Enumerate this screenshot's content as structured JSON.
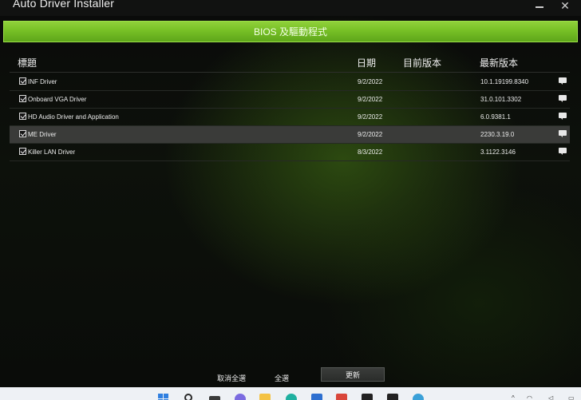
{
  "window": {
    "title": "Auto Driver Installer",
    "minimize_glyph": "—",
    "close_glyph": "✕"
  },
  "banner": {
    "label": "BIOS 及驅動程式"
  },
  "table": {
    "headers": {
      "title": "標題",
      "date": "日期",
      "current": "目前版本",
      "latest": "最新版本"
    },
    "rows": [
      {
        "name": "INF Driver",
        "date": "9/2/2022",
        "current": "",
        "latest": "10.1.19199.8340",
        "checked": true,
        "selected": false
      },
      {
        "name": "Onboard VGA Driver",
        "date": "9/2/2022",
        "current": "",
        "latest": "31.0.101.3302",
        "checked": true,
        "selected": false
      },
      {
        "name": "HD Audio Driver and Application",
        "date": "9/2/2022",
        "current": "",
        "latest": "6.0.9381.1",
        "checked": true,
        "selected": false
      },
      {
        "name": "ME Driver",
        "date": "9/2/2022",
        "current": "",
        "latest": "2230.3.19.0",
        "checked": true,
        "selected": true
      },
      {
        "name": "Killer LAN Driver",
        "date": "8/3/2022",
        "current": "",
        "latest": "3.1122.3146",
        "checked": true,
        "selected": false
      }
    ]
  },
  "actions": {
    "deselect_all": "取消全選",
    "select_all": "全選",
    "update": "更新"
  },
  "taskbar": {
    "icons": [
      "windows-start-icon",
      "search-icon",
      "task-view-icon",
      "chat-icon",
      "file-explorer-icon",
      "edge-icon",
      "store-icon",
      "gift-icon",
      "app-icon",
      "app-icon",
      "globe-icon"
    ],
    "tray": [
      "^",
      "wifi-icon",
      "speaker-icon",
      "battery-icon"
    ]
  },
  "colors": {
    "accent_green": "#77c026",
    "selected_row": "#3a3b39"
  }
}
